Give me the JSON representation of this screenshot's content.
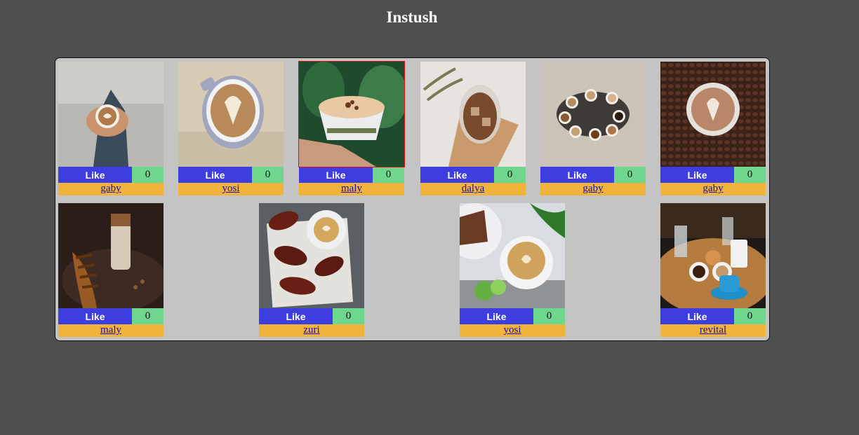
{
  "app": {
    "title": "Instush"
  },
  "posts": [
    {
      "user": "gaby",
      "like_label": "Like",
      "likes": "0",
      "image": "hands-holding-latte"
    },
    {
      "user": "yosi",
      "like_label": "Like",
      "likes": "0",
      "image": "latte-art-cup"
    },
    {
      "user": "maly",
      "like_label": "Like",
      "likes": "0",
      "image": "hand-holding-cappuccino"
    },
    {
      "user": "dalya",
      "like_label": "Like",
      "likes": "0",
      "image": "iced-coffee-glass"
    },
    {
      "user": "gaby",
      "like_label": "Like",
      "likes": "0",
      "image": "coffee-cups-circle"
    },
    {
      "user": "gaby",
      "like_label": "Like",
      "likes": "0",
      "image": "latte-on-coffee-beans"
    },
    {
      "user": "maly",
      "like_label": "Like",
      "likes": "0",
      "image": "croissant-and-milkshake"
    },
    {
      "user": "zuri",
      "like_label": "Like",
      "likes": "0",
      "image": "pastries-and-latte"
    },
    {
      "user": "yosi",
      "like_label": "Like",
      "likes": "0",
      "image": "latte-with-cake-and-lime"
    },
    {
      "user": "revital",
      "like_label": "Like",
      "likes": "0",
      "image": "coffee-table-with-cups"
    }
  ],
  "colors": {
    "background": "#4f4f4f",
    "gallery": "#c4c4c4",
    "like_button": "#3d3de0",
    "like_count": "#6fd68d",
    "user_bar": "#f0b33b"
  }
}
